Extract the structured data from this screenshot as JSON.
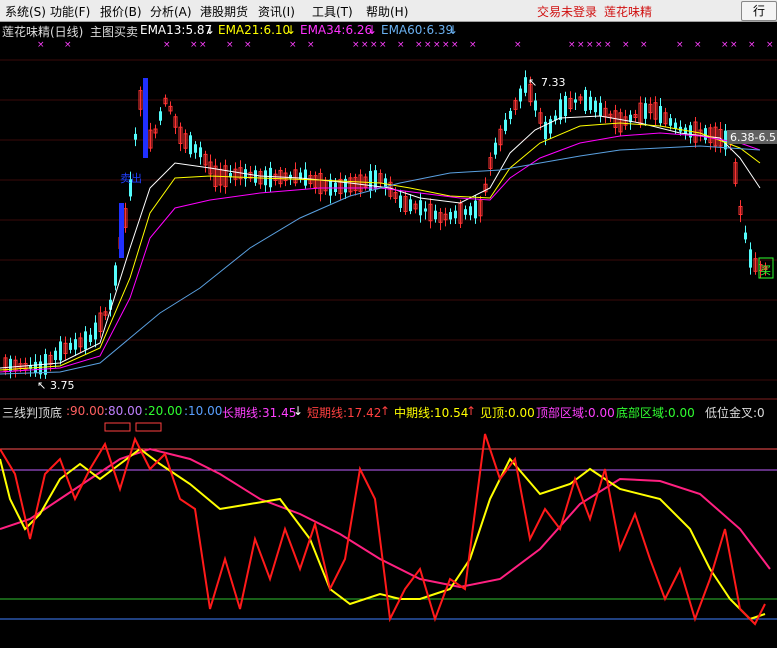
{
  "menu": {
    "items": [
      "系统(S)",
      "功能(F)",
      "报价(B)",
      "分析(A)",
      "港股期货",
      "资讯(I)",
      "工具(T)",
      "帮助(H)"
    ],
    "login_status": "交易未登录",
    "indicator_name": "莲花味精",
    "right_button": "行"
  },
  "main_panel": {
    "title": "莲花味精(日线)",
    "indicator": "主图买卖",
    "ema13": "EMA13:5.87",
    "ema21": "EMA21:6.10",
    "ema34": "EMA34:6.26",
    "ema60": "EMA60:6.39",
    "arrow_down": "↓",
    "high_label": "7.33",
    "low_label": "3.75",
    "range_label": "6.38-6.5",
    "sell_label": "卖出",
    "buy_label": "买",
    "colors": {
      "up": "#ff3333",
      "down": "#54fcfc",
      "ema13": "#ffffff",
      "ema21": "#ffff00",
      "ema34": "#ff00ff",
      "ema60": "#5aa0e0"
    }
  },
  "sub_panel": {
    "name": "三线判顶底",
    "v1": ":90.00",
    "v2": ":80.00",
    "v3": ":20.00",
    "v4": ":10.00",
    "long": "长期线:31.45",
    "short": "短期线:17.42",
    "mid": "中期线:10.54",
    "top": "见顶:0.00",
    "top_zone": "顶部区域:0.00",
    "bottom_zone": "底部区域:0.00",
    "low_cross": "低位金叉:0",
    "arrow_down": "↓",
    "arrow_up": "↑"
  }
}
